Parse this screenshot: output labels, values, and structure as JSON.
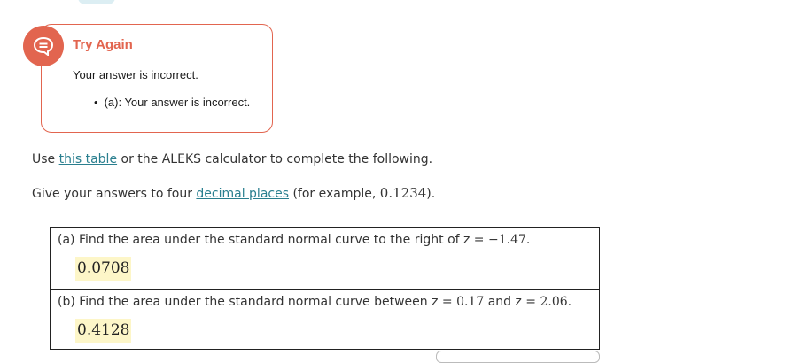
{
  "feedback": {
    "title": "Try Again",
    "message": "Your answer is incorrect.",
    "bullets": [
      "(a): Your answer is incorrect."
    ],
    "icon": "speech-bubble-icon",
    "accent_color": "#e2654f"
  },
  "instructions": {
    "line1": {
      "prefix": "Use ",
      "link": "this table",
      "suffix": " or the ALEKS calculator to complete the following."
    },
    "line2": {
      "prefix": "Give your answers to four ",
      "link": "decimal places",
      "middle": " (for example, ",
      "example": "0.1234",
      "suffix": ")."
    },
    "link_color": "#2a7f8f"
  },
  "questions": [
    {
      "label": "(a) Find the area under the standard normal curve to the right of z = ",
      "value": "−1.47",
      "end": ".",
      "answer": "0.0708"
    },
    {
      "label": "(b) Find the area under the standard normal curve between z = ",
      "value1": "0.17",
      "middle": " and z = ",
      "value2": "2.06",
      "end": ".",
      "answer": "0.4128"
    }
  ],
  "answer_highlight_color": "#fdf6c8"
}
